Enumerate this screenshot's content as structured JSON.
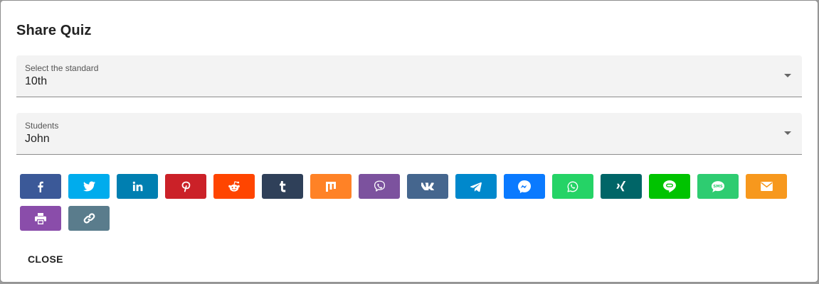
{
  "dialog": {
    "title": "Share Quiz",
    "close_label": "CLOSE"
  },
  "standard_select": {
    "label": "Select the standard",
    "value": "10th"
  },
  "students_select": {
    "label": "Students",
    "value": "John"
  },
  "share_buttons": [
    {
      "icon": "facebook-icon",
      "color": "#3b5998"
    },
    {
      "icon": "twitter-icon",
      "color": "#00aced"
    },
    {
      "icon": "linkedin-icon",
      "color": "#007fb1"
    },
    {
      "icon": "pinterest-icon",
      "color": "#cb2128"
    },
    {
      "icon": "reddit-icon",
      "color": "#ff4500"
    },
    {
      "icon": "tumblr-icon",
      "color": "#2f4059"
    },
    {
      "icon": "mix-icon",
      "color": "#ff8226"
    },
    {
      "icon": "viber-icon",
      "color": "#7c529e"
    },
    {
      "icon": "vk-icon",
      "color": "#45668e"
    },
    {
      "icon": "telegram-icon",
      "color": "#0088cc"
    },
    {
      "icon": "messenger-icon",
      "color": "#0a7aff"
    },
    {
      "icon": "whatsapp-icon",
      "color": "#25d366"
    },
    {
      "icon": "xing-icon",
      "color": "#006567"
    },
    {
      "icon": "line-icon",
      "color": "#00c300"
    },
    {
      "icon": "sms-icon",
      "color": "#2ecc71"
    },
    {
      "icon": "email-icon",
      "color": "#f7981d"
    },
    {
      "icon": "print-icon",
      "color": "#8a4daa"
    },
    {
      "icon": "link-icon",
      "color": "#5a7c8c"
    }
  ]
}
